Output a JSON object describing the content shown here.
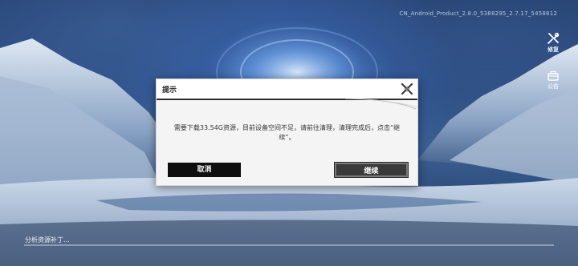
{
  "header": {
    "build_version": "CN_Android_Product_2.8.0_5388295_2.7.17_5458812"
  },
  "side_buttons": {
    "repair_label": "修复",
    "repair_icon": "wrench-screwdriver-icon",
    "notice_label": "公告",
    "notice_icon": "mailbox-icon"
  },
  "dialog": {
    "title": "提示",
    "message": "需要下载33.54G资源，目前设备空间不足，请前往清理，清理完成后，点击“继续”。",
    "cancel_label": "取消",
    "continue_label": "继续",
    "close_icon": "close-x-icon"
  },
  "status": {
    "text": "分析资源补丁...",
    "progress": 0
  }
}
